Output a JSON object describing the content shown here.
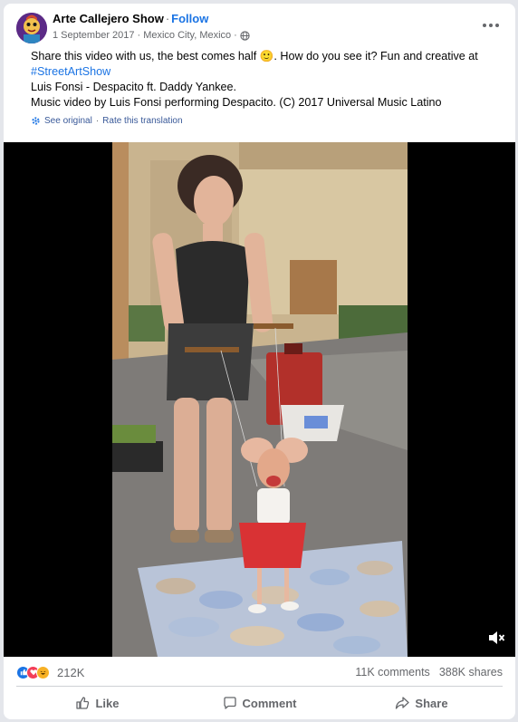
{
  "post": {
    "author": "Arte Callejero Show",
    "separator": "·",
    "follow_label": "Follow",
    "date": "1 September 2017",
    "location": "Mexico City, Mexico",
    "meta_separator": "·",
    "text_line1": "Share this video with us, the best comes half 🙂. How do you see it? Fun and creative at",
    "hashtag": "#StreetArtShow",
    "text_line3": "Luis Fonsi - Despacito ft. Daddy Yankee.",
    "text_line4": "Music video by Luis Fonsi performing Despacito. (C) 2017 Universal Music Latino",
    "see_original": "See original",
    "translate_separator": "·",
    "rate_translation": "Rate this translation"
  },
  "stats": {
    "reactions": "212K",
    "comments": "11K comments",
    "shares": "388K shares"
  },
  "actions": {
    "like": "Like",
    "comment": "Comment",
    "share": "Share"
  },
  "icons": {
    "globe": "globe-icon",
    "more": "more-options-icon",
    "mute": "speaker-muted-icon",
    "settings": "gear-icon",
    "like": "thumbs-up-icon",
    "comment": "speech-bubble-icon",
    "share": "share-arrow-icon"
  },
  "colors": {
    "accent": "#1b74e4",
    "secondary_text": "#65676b",
    "like_reaction": "#1b74e4",
    "love_reaction": "#f33e58",
    "haha_reaction": "#f7b125"
  }
}
